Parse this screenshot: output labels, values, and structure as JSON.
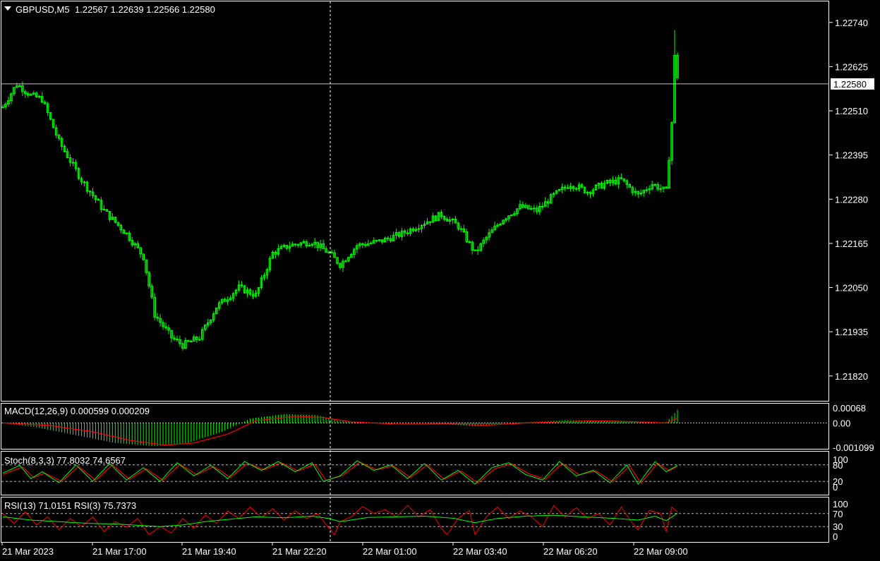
{
  "header": {
    "symbol": "GBPUSD,M5",
    "ohlc": "1.22567 1.22639 1.22566 1.22580"
  },
  "colors": {
    "background": "#000000",
    "candle": "#00ff00",
    "signal": "#ff0000",
    "grid": "#c0c0c0"
  },
  "chart_data": [
    {
      "type": "candlestick",
      "name": "price",
      "ylim": [
        1.2177,
        1.2278
      ],
      "y_ticks": [
        "1.22740",
        "1.22625",
        "1.22510",
        "1.22395",
        "1.22280",
        "1.22165",
        "1.22050",
        "1.21935",
        "1.21820"
      ],
      "current_price": "1.22580",
      "x_ticks": [
        "21 Mar 2023",
        "21 Mar 17:00",
        "21 Mar 19:40",
        "21 Mar 22:20",
        "22 Mar 01:00",
        "22 Mar 03:40",
        "22 Mar 06:20",
        "22 Mar 09:00"
      ],
      "path": [
        [
          0,
          1.2252
        ],
        [
          5,
          1.2258
        ],
        [
          10,
          1.2255
        ],
        [
          14,
          1.2254
        ],
        [
          20,
          1.2243
        ],
        [
          28,
          1.2233
        ],
        [
          36,
          1.2225
        ],
        [
          44,
          1.2219
        ],
        [
          50,
          1.2213
        ],
        [
          54,
          1.2198
        ],
        [
          60,
          1.2192
        ],
        [
          64,
          1.219
        ],
        [
          70,
          1.2192
        ],
        [
          76,
          1.22
        ],
        [
          84,
          1.2205
        ],
        [
          90,
          1.2203
        ],
        [
          96,
          1.2214
        ],
        [
          102,
          1.2216
        ],
        [
          110,
          1.2217
        ],
        [
          116,
          1.2214
        ],
        [
          120,
          1.2211
        ],
        [
          126,
          1.2216
        ],
        [
          134,
          1.2217
        ],
        [
          142,
          1.2219
        ],
        [
          150,
          1.2222
        ],
        [
          156,
          1.2224
        ],
        [
          162,
          1.2221
        ],
        [
          168,
          1.2214
        ],
        [
          172,
          1.2218
        ],
        [
          178,
          1.2223
        ],
        [
          184,
          1.2226
        ],
        [
          190,
          1.2225
        ],
        [
          196,
          1.2229
        ],
        [
          202,
          1.2232
        ],
        [
          208,
          1.223
        ],
        [
          214,
          1.2232
        ],
        [
          220,
          1.2233
        ],
        [
          226,
          1.2229
        ],
        [
          231,
          1.2232
        ],
        [
          236,
          1.223
        ],
        [
          238,
          1.2248
        ],
        [
          239,
          1.2265
        ],
        [
          240,
          1.226
        ]
      ]
    },
    {
      "type": "bar-line",
      "name": "macd",
      "label": "MACD(12,26,9) 0.000599 0.000209",
      "y_ticks": [
        "0.00068",
        "0.00",
        "-0.001099"
      ],
      "ylim": [
        -0.001099,
        0.00068
      ],
      "histogram_path": [
        [
          0,
          0.0
        ],
        [
          12,
          -0.0002
        ],
        [
          28,
          -0.0006
        ],
        [
          40,
          -0.0009
        ],
        [
          54,
          -0.00105
        ],
        [
          66,
          -0.0009
        ],
        [
          78,
          -0.0004
        ],
        [
          88,
          0.0002
        ],
        [
          100,
          0.0004
        ],
        [
          112,
          0.00035
        ],
        [
          120,
          0.0001
        ],
        [
          130,
          0.0
        ],
        [
          150,
          0.0
        ],
        [
          168,
          -0.00015
        ],
        [
          180,
          0.0
        ],
        [
          200,
          0.00012
        ],
        [
          220,
          0.0001
        ],
        [
          232,
          0.0
        ],
        [
          236,
          5e-05
        ],
        [
          238,
          0.0003
        ],
        [
          240,
          0.000599
        ]
      ],
      "signal_path": [
        [
          0,
          0.0
        ],
        [
          16,
          -0.0001
        ],
        [
          32,
          -0.0004
        ],
        [
          46,
          -0.0008
        ],
        [
          58,
          -0.001
        ],
        [
          68,
          -0.0009
        ],
        [
          80,
          -0.0005
        ],
        [
          90,
          0.0001
        ],
        [
          104,
          0.0003
        ],
        [
          114,
          0.00025
        ],
        [
          124,
          5e-05
        ],
        [
          140,
          -5e-05
        ],
        [
          160,
          -5e-05
        ],
        [
          172,
          -0.0001
        ],
        [
          186,
          0.0
        ],
        [
          210,
          0.0001
        ],
        [
          226,
          5e-05
        ],
        [
          236,
          0.0
        ],
        [
          240,
          0.000209
        ]
      ]
    },
    {
      "type": "line",
      "name": "stochastic",
      "label": "Stoch(8,3,3) 77.8032 74.6567",
      "y_ticks": [
        "100",
        "80",
        "20",
        "0"
      ],
      "ylim": [
        0,
        100
      ],
      "levels": [
        80,
        20
      ],
      "main_path": [
        [
          0,
          50
        ],
        [
          6,
          78
        ],
        [
          10,
          30
        ],
        [
          14,
          55
        ],
        [
          20,
          15
        ],
        [
          26,
          80
        ],
        [
          32,
          20
        ],
        [
          38,
          85
        ],
        [
          44,
          25
        ],
        [
          50,
          70
        ],
        [
          56,
          20
        ],
        [
          62,
          88
        ],
        [
          68,
          40
        ],
        [
          74,
          78
        ],
        [
          80,
          30
        ],
        [
          86,
          92
        ],
        [
          92,
          60
        ],
        [
          98,
          92
        ],
        [
          104,
          55
        ],
        [
          110,
          88
        ],
        [
          114,
          20
        ],
        [
          120,
          40
        ],
        [
          126,
          95
        ],
        [
          132,
          60
        ],
        [
          138,
          80
        ],
        [
          144,
          30
        ],
        [
          150,
          85
        ],
        [
          156,
          25
        ],
        [
          162,
          60
        ],
        [
          168,
          10
        ],
        [
          174,
          70
        ],
        [
          180,
          88
        ],
        [
          186,
          45
        ],
        [
          192,
          25
        ],
        [
          198,
          92
        ],
        [
          204,
          40
        ],
        [
          210,
          60
        ],
        [
          216,
          15
        ],
        [
          222,
          80
        ],
        [
          226,
          10
        ],
        [
          232,
          92
        ],
        [
          236,
          55
        ],
        [
          240,
          77.8
        ]
      ],
      "signal_path": [
        [
          0,
          45
        ],
        [
          7,
          72
        ],
        [
          11,
          34
        ],
        [
          15,
          50
        ],
        [
          21,
          20
        ],
        [
          27,
          74
        ],
        [
          33,
          24
        ],
        [
          39,
          80
        ],
        [
          45,
          28
        ],
        [
          51,
          66
        ],
        [
          57,
          24
        ],
        [
          63,
          82
        ],
        [
          69,
          44
        ],
        [
          75,
          74
        ],
        [
          81,
          34
        ],
        [
          87,
          86
        ],
        [
          93,
          62
        ],
        [
          99,
          88
        ],
        [
          105,
          58
        ],
        [
          111,
          82
        ],
        [
          115,
          24
        ],
        [
          121,
          42
        ],
        [
          127,
          90
        ],
        [
          133,
          62
        ],
        [
          139,
          76
        ],
        [
          145,
          34
        ],
        [
          151,
          80
        ],
        [
          157,
          28
        ],
        [
          163,
          58
        ],
        [
          169,
          14
        ],
        [
          175,
          66
        ],
        [
          181,
          84
        ],
        [
          187,
          48
        ],
        [
          193,
          28
        ],
        [
          199,
          86
        ],
        [
          205,
          44
        ],
        [
          211,
          58
        ],
        [
          217,
          18
        ],
        [
          223,
          76
        ],
        [
          227,
          14
        ],
        [
          233,
          86
        ],
        [
          237,
          58
        ],
        [
          240,
          74.66
        ]
      ]
    },
    {
      "type": "line",
      "name": "rsi",
      "label": "RSI(13) 71.0151  RSI(3) 75.7373",
      "y_ticks": [
        "100",
        "70",
        "30",
        "0"
      ],
      "ylim": [
        0,
        100
      ],
      "levels": [
        70,
        30
      ],
      "rsi13_path": [
        [
          0,
          60
        ],
        [
          10,
          50
        ],
        [
          20,
          45
        ],
        [
          30,
          40
        ],
        [
          40,
          38
        ],
        [
          50,
          33
        ],
        [
          56,
          30
        ],
        [
          64,
          35
        ],
        [
          72,
          45
        ],
        [
          80,
          52
        ],
        [
          90,
          60
        ],
        [
          100,
          57
        ],
        [
          110,
          62
        ],
        [
          116,
          55
        ],
        [
          120,
          45
        ],
        [
          130,
          58
        ],
        [
          140,
          60
        ],
        [
          150,
          62
        ],
        [
          160,
          56
        ],
        [
          168,
          42
        ],
        [
          176,
          55
        ],
        [
          186,
          62
        ],
        [
          196,
          65
        ],
        [
          206,
          60
        ],
        [
          216,
          56
        ],
        [
          226,
          50
        ],
        [
          232,
          62
        ],
        [
          236,
          48
        ],
        [
          240,
          71
        ]
      ],
      "rsi3_path": [
        [
          0,
          70
        ],
        [
          4,
          40
        ],
        [
          8,
          75
        ],
        [
          12,
          35
        ],
        [
          16,
          60
        ],
        [
          20,
          20
        ],
        [
          24,
          55
        ],
        [
          28,
          30
        ],
        [
          32,
          60
        ],
        [
          36,
          15
        ],
        [
          40,
          45
        ],
        [
          44,
          28
        ],
        [
          48,
          55
        ],
        [
          52,
          5
        ],
        [
          56,
          30
        ],
        [
          60,
          10
        ],
        [
          64,
          55
        ],
        [
          68,
          25
        ],
        [
          72,
          65
        ],
        [
          76,
          40
        ],
        [
          80,
          78
        ],
        [
          84,
          55
        ],
        [
          88,
          90
        ],
        [
          92,
          58
        ],
        [
          96,
          85
        ],
        [
          100,
          50
        ],
        [
          104,
          78
        ],
        [
          108,
          55
        ],
        [
          112,
          70
        ],
        [
          116,
          25
        ],
        [
          118,
          5
        ],
        [
          120,
          45
        ],
        [
          124,
          60
        ],
        [
          128,
          92
        ],
        [
          132,
          70
        ],
        [
          136,
          82
        ],
        [
          140,
          60
        ],
        [
          144,
          95
        ],
        [
          148,
          60
        ],
        [
          152,
          82
        ],
        [
          156,
          25
        ],
        [
          158,
          5
        ],
        [
          162,
          55
        ],
        [
          166,
          80
        ],
        [
          168,
          5
        ],
        [
          172,
          60
        ],
        [
          176,
          90
        ],
        [
          180,
          55
        ],
        [
          184,
          78
        ],
        [
          188,
          60
        ],
        [
          192,
          30
        ],
        [
          196,
          95
        ],
        [
          200,
          60
        ],
        [
          204,
          88
        ],
        [
          208,
          55
        ],
        [
          212,
          70
        ],
        [
          216,
          35
        ],
        [
          220,
          90
        ],
        [
          224,
          40
        ],
        [
          226,
          20
        ],
        [
          230,
          80
        ],
        [
          234,
          70
        ],
        [
          236,
          15
        ],
        [
          238,
          90
        ],
        [
          240,
          75.7
        ]
      ]
    }
  ]
}
